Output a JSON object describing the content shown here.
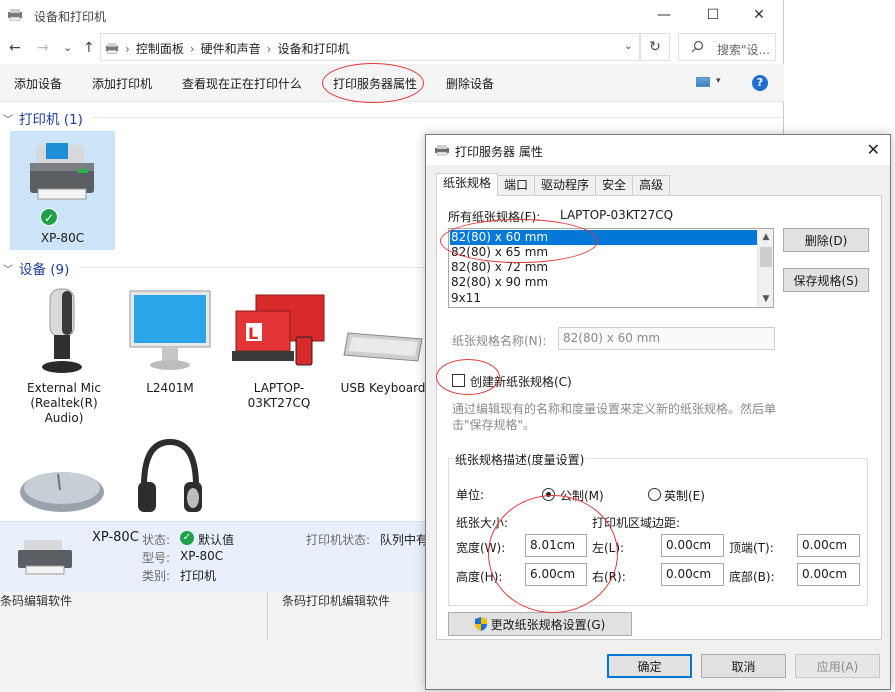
{
  "explorer": {
    "title": "设备和打印机",
    "window_buttons": [
      "—",
      "☐",
      "✕"
    ],
    "nav": {
      "back": "←",
      "forward": "→",
      "recent": "⌄",
      "up": "↑"
    },
    "breadcrumb": [
      "控制面板",
      "硬件和声音",
      "设备和打印机"
    ],
    "breadcrumb_sep": "›",
    "addr_dropdown": "⌄",
    "refresh": "↻",
    "search_placeholder": "搜索\"设...",
    "toolbar": {
      "add_device": "添加设备",
      "add_printer": "添加打印机",
      "see_printing": "查看现在正在打印什么",
      "print_server_props": "打印服务器属性",
      "remove_device": "删除设备",
      "view_drop": "▾",
      "help": "?"
    },
    "printers_header": "打印机 (1)",
    "devices_header": "设备 (9)",
    "printers": [
      {
        "name": "XP-80C"
      }
    ],
    "devices": [
      {
        "name": "External Mic (Realtek(R) Audio)"
      },
      {
        "name": "L2401M"
      },
      {
        "name": "LAPTOP-03KT27CQ"
      },
      {
        "name": "USB Keyboard"
      }
    ],
    "details": {
      "name": "XP-80C",
      "status_label": "状态:",
      "status_value": "默认值",
      "model_label": "型号:",
      "model_value": "XP-80C",
      "category_label": "类别:",
      "category_value": "打印机",
      "printer_status_label": "打印机状态:",
      "printer_status_value": "队列中有"
    }
  },
  "background": {
    "left_text": "条码编辑软件",
    "right_text": "条码打印机编辑软件"
  },
  "dialog": {
    "title": "打印服务器 属性",
    "close": "✕",
    "tabs": [
      "纸张规格",
      "端口",
      "驱动程序",
      "安全",
      "高级"
    ],
    "all_forms_label": "所有纸张规格(F):",
    "server_name": "LAPTOP-03KT27CQ",
    "forms": [
      "82(80) x 60 mm",
      "82(80) x 65 mm",
      "82(80) x 72 mm",
      "82(80) x 90 mm",
      "9x11"
    ],
    "selected_form": 0,
    "delete_btn": "删除(D)",
    "save_btn": "保存规格(S)",
    "form_name_label": "纸张规格名称(N):",
    "form_name_value": "82(80) x 60 mm",
    "create_new_label": "创建新纸张规格(C)",
    "create_new_checked": false,
    "hint": "通过编辑现有的名称和度量设置来定义新的纸张规格。然后单击\"保存规格\"。",
    "desc_group": "纸张规格描述(度量设置)",
    "units_label": "单位:",
    "metric_label": "公制(M)",
    "english_label": "英制(E)",
    "units_selected": "metric",
    "paper_size_label": "纸张大小:",
    "margins_label": "打印机区域边距:",
    "width_label": "宽度(W):",
    "width_value": "8.01cm",
    "height_label": "高度(H):",
    "height_value": "6.00cm",
    "left_label": "左(L):",
    "left_value": "0.00cm",
    "right_label": "右(R):",
    "right_value": "0.00cm",
    "top_label": "顶端(T):",
    "top_value": "0.00cm",
    "bottom_label": "底部(B):",
    "bottom_value": "0.00cm",
    "change_settings_btn": "更改纸张规格设置(G)",
    "ok_btn": "确定",
    "cancel_btn": "取消",
    "apply_btn": "应用(A)"
  },
  "colors": {
    "accent": "#0078d7",
    "header_blue": "#1e3f9a",
    "annotation": "#e03a3a"
  }
}
